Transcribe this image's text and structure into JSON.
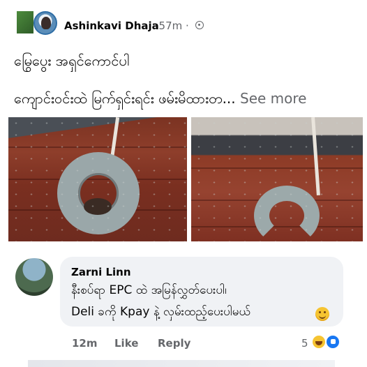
{
  "post": {
    "author": "Ashinkavi Dhaja",
    "meta": "· 57m ·",
    "text_line1": "မြွေပွေး အရှင်ကောင်ပါ",
    "text_line2": "ကျောင်းဝင်းထဲ မြက်ရှင်းရင်း ဖမ်းမိထားတ...",
    "see_more": " See more",
    "privacy_icon": "globe-icon"
  },
  "comment": {
    "author": "Zarni Linn",
    "line1": "နီးစပ်ရာ EPC ထဲ အမြန်လွှတ်ပေးပါ၊",
    "line2": "Deli ခကို Kpay နဲ့ လှမ်းထည့်ပေးပါမယ်",
    "time": "12m",
    "like_label": "Like",
    "reply_label": "Reply",
    "reaction_count": "5",
    "reactions": [
      "haha-icon",
      "like-icon"
    ]
  },
  "colors": {
    "secondary_text": "#65676b",
    "bubble": "#f0f2f5",
    "like_blue": "#1877f2"
  }
}
